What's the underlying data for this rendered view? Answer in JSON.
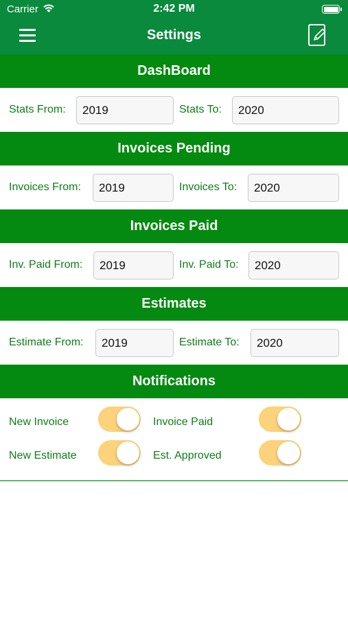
{
  "status_bar": {
    "carrier": "Carrier",
    "time": "2:42 PM"
  },
  "nav": {
    "title": "Settings",
    "menu_icon": "hamburger-menu-icon",
    "edit_icon": "edit-note-icon"
  },
  "dashboard": {
    "header": "DashBoard",
    "from_label": "Stats From:",
    "from_value": "2019",
    "to_label": "Stats To:",
    "to_value": "2020"
  },
  "invoices_pending": {
    "header": "Invoices Pending",
    "from_label": "Invoices From:",
    "from_value": "2019",
    "to_label": "Invoices To:",
    "to_value": "2020"
  },
  "invoices_paid": {
    "header": "Invoices Paid",
    "from_label": "Inv. Paid From:",
    "from_value": "2019",
    "to_label": "Inv. Paid To:",
    "to_value": "2020"
  },
  "estimates": {
    "header": "Estimates",
    "from_label": "Estimate From:",
    "from_value": "2019",
    "to_label": "Estimate To:",
    "to_value": "2020"
  },
  "notifications": {
    "header": "Notifications",
    "new_invoice": {
      "label": "New Invoice",
      "on": true
    },
    "invoice_paid": {
      "label": "Invoice Paid",
      "on": true
    },
    "new_estimate": {
      "label": "New Estimate",
      "on": true
    },
    "est_approved": {
      "label": "Est. Approved",
      "on": true
    }
  },
  "colors": {
    "nav": "#0a8a3c",
    "section_header": "#048a10",
    "label_green": "#0e7d17",
    "toggle_on": "#fcd27a"
  }
}
